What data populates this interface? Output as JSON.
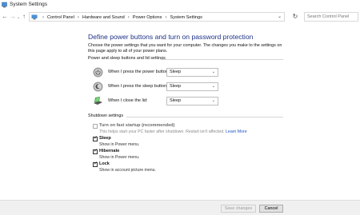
{
  "window": {
    "title": "System Settings",
    "app_icon": "control-panel-icon"
  },
  "nav": {
    "back_icon": "back-arrow-icon",
    "forward_icon": "forward-arrow-icon",
    "up_icon": "up-arrow-icon",
    "breadcrumbs": [
      "Control Panel",
      "Hardware and Sound",
      "Power Options",
      "System Settings"
    ],
    "search_placeholder": "Search Control Panel"
  },
  "main": {
    "heading": "Define power buttons and turn on password protection",
    "intro": "Choose the power settings that you want for your computer. The changes you make to the settings on this page apply to all of your power plans.",
    "power_section_title": "Power and sleep buttons and lid settings",
    "rows": [
      {
        "label": "When I press the power button:",
        "value": "Sleep",
        "icon": "power-button-icon"
      },
      {
        "label": "When I press the sleep button:",
        "value": "Sleep",
        "icon": "sleep-button-icon"
      },
      {
        "label": "When I close the lid:",
        "value": "Sleep",
        "icon": "laptop-lid-icon"
      }
    ],
    "shutdown_section_title": "Shutdown settings",
    "options": [
      {
        "title": "Turn on fast startup (recommended)",
        "desc": "This helps start your PC faster after shutdown. Restart isn't affected.",
        "link": "Learn More",
        "checked": false,
        "disabled": true
      },
      {
        "title": "Sleep",
        "desc": "Show in Power menu.",
        "checked": true,
        "disabled": false
      },
      {
        "title": "Hibernate",
        "desc": "Show in Power menu.",
        "checked": true,
        "disabled": false
      },
      {
        "title": "Lock",
        "desc": "Show in account picture menu.",
        "checked": true,
        "disabled": false
      }
    ]
  },
  "footer": {
    "save_label": "Save changes",
    "cancel_label": "Cancel"
  },
  "colors": {
    "heading": "#1e3287",
    "link": "#1e55c8",
    "footer_bg": "#f0f0f0"
  }
}
